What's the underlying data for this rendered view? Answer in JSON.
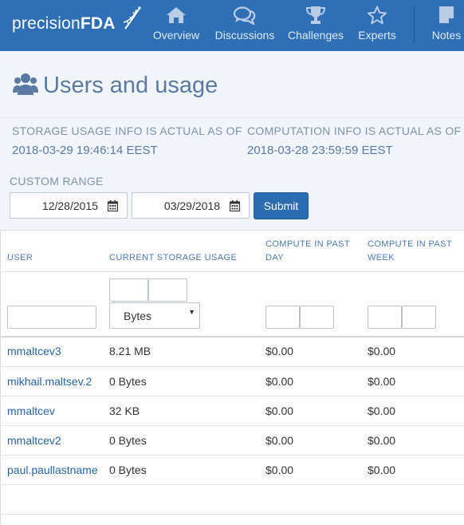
{
  "brand": {
    "name_light": "precision",
    "name_bold": "FDA"
  },
  "nav": [
    {
      "label": "Overview",
      "icon": "home-icon"
    },
    {
      "label": "Discussions",
      "icon": "comments-icon"
    },
    {
      "label": "Challenges",
      "icon": "trophy-icon"
    },
    {
      "label": "Experts",
      "icon": "star-icon"
    },
    {
      "label": "Notes",
      "icon": "note-icon"
    }
  ],
  "page": {
    "title": "Users and usage"
  },
  "info": {
    "storage_label": "STORAGE USAGE INFO IS ACTUAL AS OF",
    "storage_value": "2018-03-29 19:46:14 EEST",
    "compute_label": "COMPUTATION INFO IS ACTUAL AS OF",
    "compute_value": "2018-03-28 23:59:59 EEST"
  },
  "range": {
    "label": "CUSTOM RANGE",
    "start": "12/28/2015",
    "end": "03/29/2018",
    "submit": "Submit"
  },
  "table": {
    "headers": {
      "user": "USER",
      "storage": "CURRENT STORAGE USAGE",
      "compute_day_1": "COMPUTE IN PAST",
      "compute_day_2": "DAY",
      "compute_week_1": "COMPUTE IN PAST",
      "compute_week_2": "WEEK"
    },
    "unit_select": "Bytes",
    "rows": [
      {
        "user": "mmaltcev3",
        "storage": "8.21 MB",
        "day": "$0.00",
        "week": "$0.00"
      },
      {
        "user": "mikhail.maltsev.2",
        "storage": "0 Bytes",
        "day": "$0.00",
        "week": "$0.00"
      },
      {
        "user": "mmaltcev",
        "storage": "32 KB",
        "day": "$0.00",
        "week": "$0.00"
      },
      {
        "user": "mmaltcev2",
        "storage": "0 Bytes",
        "day": "$0.00",
        "week": "$0.00"
      },
      {
        "user": "paul.paullastname",
        "storage": "0 Bytes",
        "day": "$0.00",
        "week": "$0.00"
      }
    ]
  },
  "colors": {
    "navbar": "#2f6fb5",
    "accent": "#2b6cb3",
    "title": "#5a7aa2",
    "link": "#2a65a8"
  }
}
